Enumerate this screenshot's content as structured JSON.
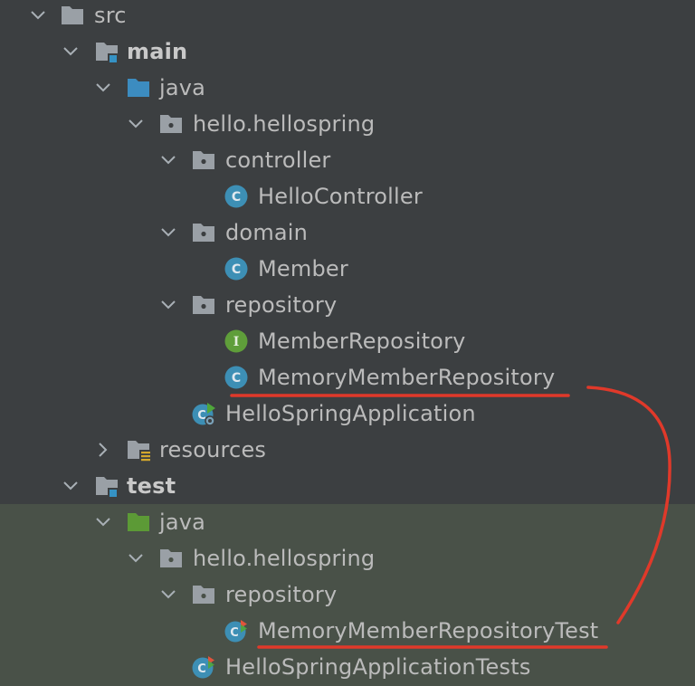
{
  "tree": {
    "src": "src",
    "main": "main",
    "main_java": "java",
    "main_pkg": "hello.hellospring",
    "controller": "controller",
    "hello_controller": "HelloController",
    "domain": "domain",
    "member": "Member",
    "repository": "repository",
    "member_repository": "MemberRepository",
    "memory_member_repository": "MemoryMemberRepository",
    "hello_spring_application": "HelloSpringApplication",
    "resources": "resources",
    "test": "test",
    "test_java": "java",
    "test_pkg": "hello.hellospring",
    "test_repository": "repository",
    "memory_member_repository_test": "MemoryMemberRepositoryTest",
    "hello_spring_application_tests": "HelloSpringApplicationTests"
  },
  "colors": {
    "background": "#3c3f41",
    "test_highlight": "#495148",
    "annotation": "#e0392a",
    "class_icon": "#3d8fb5",
    "interface_icon": "#5f9e3a",
    "folder": "#9aa0a6",
    "source_root": "#3c8cc0",
    "test_root": "#5c9a36"
  }
}
